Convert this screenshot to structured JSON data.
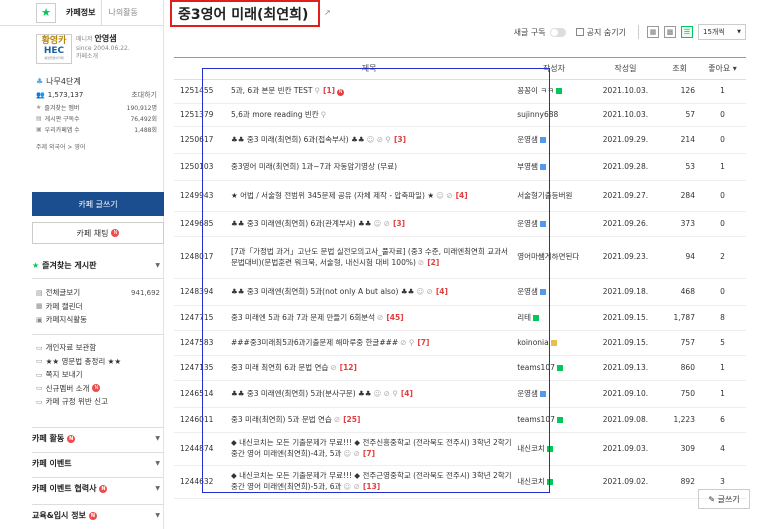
{
  "sidebar": {
    "tabs": {
      "info": "카페정보",
      "activity": "나의활동"
    },
    "profile": {
      "logo_line1": "황영카",
      "logo_line2": "HEC",
      "logo_line3": "황영현영어카페",
      "manager_role": "매니저",
      "manager_name": "안영샘",
      "since": "since 2004.06.22.",
      "intro": "카페소개"
    },
    "rank": "나무4단계",
    "members": "1,573,137",
    "invite": "초대하기",
    "stats": [
      {
        "label": "즐겨찾는 멤버",
        "value": "190,912명"
      },
      {
        "label": "게시판 구독수",
        "value": "76,492회"
      },
      {
        "label": "우리카페앱 수",
        "value": "1,488회"
      }
    ],
    "topic": "주제 외국어 > 영어",
    "write_button": "카페 글쓰기",
    "chat_button": "카페 채팅",
    "favorites_header": "즐겨찾는 게시판",
    "menu_group1": [
      {
        "label": "전체글보기",
        "count": "941,692"
      },
      {
        "label": "카페 캘린더",
        "count": ""
      },
      {
        "label": "카페지식활동",
        "count": ""
      }
    ],
    "menu_group2": [
      {
        "label": "개인자료 보관함"
      },
      {
        "label": "★★ 영문법 총정리 ★★"
      },
      {
        "label": "쪽지 보내기"
      },
      {
        "label": "신규멤버 소개"
      },
      {
        "label": "카페 규정 위반 신고"
      }
    ],
    "sections": [
      "카페 활동",
      "카페 이벤트",
      "카페 이벤트 협력사",
      "교육&입시 정보"
    ]
  },
  "main": {
    "board_title": "중3영어 미래(최연희)",
    "subscribe_label": "새글 구독",
    "hide_notice_label": "공지 숨기기",
    "page_size": "15개씩",
    "columns": {
      "title": "제목",
      "author": "작성자",
      "date": "작성일",
      "views": "조회",
      "likes": "좋아요"
    },
    "write_button": "글쓰기",
    "rows": [
      {
        "no": "1251455",
        "title": "5과, 6과 본문 빈칸 TEST",
        "comments": "[1]",
        "author": "꽁꽁이 ㅋㅋ",
        "date": "2021.10.03.",
        "views": "126",
        "likes": "1"
      },
      {
        "no": "1251379",
        "title": "5,6과 more reading 빈칸",
        "comments": "",
        "author": "sujinny688",
        "date": "2021.10.03.",
        "views": "57",
        "likes": "0"
      },
      {
        "no": "1250617",
        "title": "♣♣ 중3 미래(최연희) 6과(접속부사) ♣♣",
        "comments": "[3]",
        "author": "운영샘",
        "date": "2021.09.29.",
        "views": "214",
        "likes": "0"
      },
      {
        "no": "1250103",
        "title": "중3영어 미래(최연희) 1과~7과 자동암기영상 (무료)",
        "comments": "",
        "author": "부영쌤",
        "date": "2021.09.28.",
        "views": "53",
        "likes": "1"
      },
      {
        "no": "1249943",
        "title": "★ 어법 / 서술형 전범위 345문제 공유 (자체 제작 - 압축파일) ★",
        "comments": "[4]",
        "author": "서술형기출등버원",
        "date": "2021.09.27.",
        "views": "284",
        "likes": "0"
      },
      {
        "no": "1249685",
        "title": "♣♣ 중3 미래엔(최연희) 6과(관계부사) ♣♣",
        "comments": "[3]",
        "author": "운영샘",
        "date": "2021.09.26.",
        "views": "373",
        "likes": "0"
      },
      {
        "no": "1248017",
        "title": "[7과「가정법 과거」고난도 문법 실전모의고사_풀자료] (중3 수준, 미래엔최연희 교과서 문법대비)(문법훈련 워크북, 서술형, 내신시험 대비 100%)",
        "comments": "[2]",
        "author": "영어마쌤게하면된다",
        "date": "2021.09.23.",
        "views": "94",
        "likes": "2"
      },
      {
        "no": "1248394",
        "title": "♣♣ 중3 미래엔(최연희) 5과(not only A but also) ♣♣",
        "comments": "[4]",
        "author": "운영샘",
        "date": "2021.09.18.",
        "views": "468",
        "likes": "0"
      },
      {
        "no": "1247715",
        "title": "중3 미래엔 5과 6과 7과 문제 만들기 6회분석",
        "comments": "[45]",
        "author": "리테",
        "date": "2021.09.15.",
        "views": "1,787",
        "likes": "8"
      },
      {
        "no": "1247583",
        "title": "###중3미래최5과6과기출문제 해마루중 한글###",
        "comments": "[7]",
        "author": "koinonia",
        "date": "2021.09.15.",
        "views": "757",
        "likes": "5"
      },
      {
        "no": "1247135",
        "title": "중3 미래 최연희 6과 문법 연습",
        "comments": "[12]",
        "author": "teams107",
        "date": "2021.09.13.",
        "views": "860",
        "likes": "1"
      },
      {
        "no": "1246514",
        "title": "♣♣ 중3 미래엔(최연희) 5과(분사구문) ♣♣",
        "comments": "[4]",
        "author": "운영샘",
        "date": "2021.09.10.",
        "views": "750",
        "likes": "1"
      },
      {
        "no": "1246011",
        "title": "중3 미래(최연희) 5과 문법 연습",
        "comments": "[25]",
        "author": "teams107",
        "date": "2021.09.08.",
        "views": "1,223",
        "likes": "6"
      },
      {
        "no": "1244874",
        "title": "◆ 내신코치는 모든 기출문제가 무료!!! ◆ 전주신흥중학교 (전라북도 전주시) 3학년 2학기 중간 영어 미래엔(최연희)-4과, 5과",
        "comments": "[7]",
        "author": "내신코치",
        "date": "2021.09.03.",
        "views": "309",
        "likes": "4"
      },
      {
        "no": "1244632",
        "title": "◆ 내신코치는 모든 기출문제가 무료!!! ◆ 전주근영중학교 (전라북도 전주시) 3학년 2학기 중간 영어 미래엔(최연희)-5과, 6과",
        "comments": "[13]",
        "author": "내신코치",
        "date": "2021.09.02.",
        "views": "892",
        "likes": "3"
      }
    ]
  }
}
